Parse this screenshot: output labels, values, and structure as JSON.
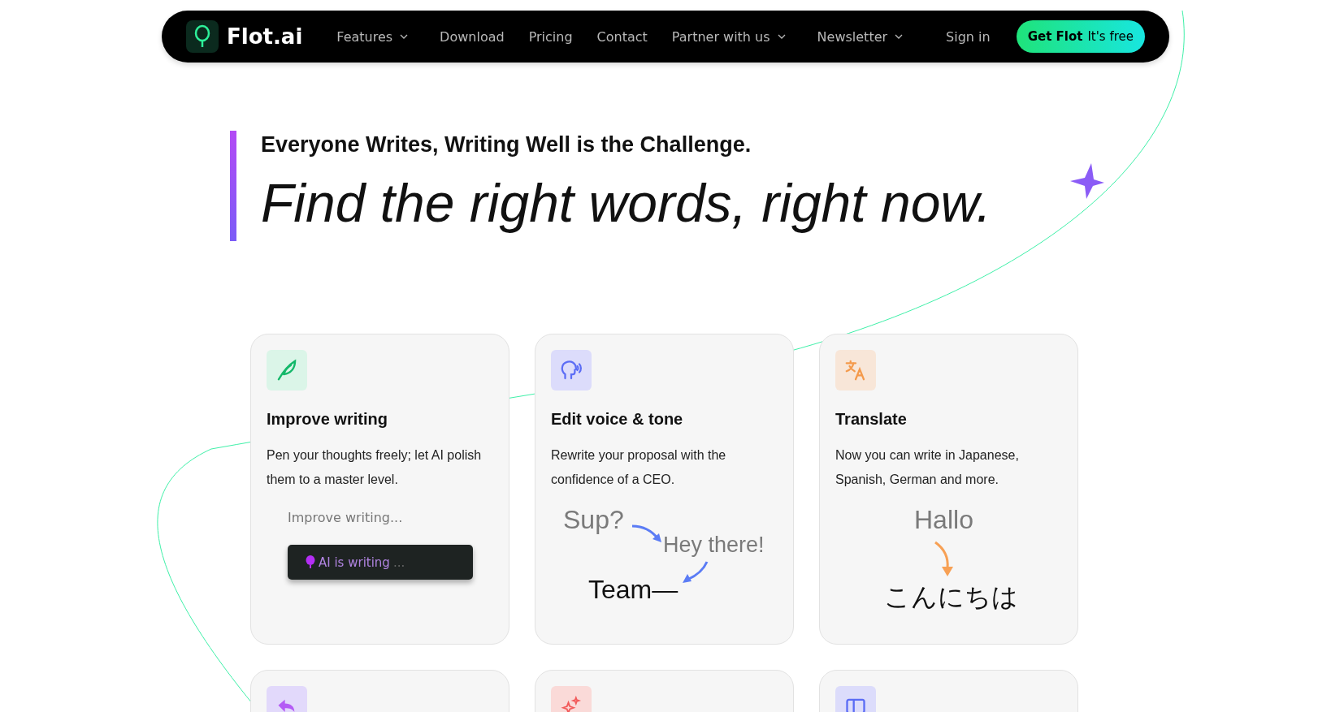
{
  "nav": {
    "brand": "Flot.ai",
    "links": [
      {
        "label": "Features",
        "dropdown": true
      },
      {
        "label": "Download",
        "dropdown": false
      },
      {
        "label": "Pricing",
        "dropdown": false
      },
      {
        "label": "Contact",
        "dropdown": false
      },
      {
        "label": "Partner with us",
        "dropdown": true
      },
      {
        "label": "Newsletter",
        "dropdown": true
      }
    ],
    "sign_in": "Sign in",
    "cta": {
      "strong": "Get Flot",
      "light": "It's free"
    }
  },
  "hero": {
    "subtitle": "Everyone Writes, Writing Well is the Challenge.",
    "headline": "Find the right words, right now."
  },
  "cards": [
    {
      "kind": "writing",
      "title": "Improve writing",
      "text": "Pen your thoughts freely; let AI polish them to a master level.",
      "demo": {
        "prompt": "Improve writing...",
        "status": "AI is writing",
        "dots": "..."
      }
    },
    {
      "kind": "tone",
      "title": "Edit voice & tone",
      "text": "Rewrite your proposal with the confidence of a CEO.",
      "demo": {
        "from": "Sup?",
        "middle": "Hey there!",
        "to": "Team—"
      }
    },
    {
      "kind": "translate",
      "title": "Translate",
      "text": "Now you can write in Japanese, Spanish, German and more.",
      "demo": {
        "from": "Hallo",
        "to": "こんにちは"
      }
    }
  ],
  "more_cards": [
    {
      "kind": "undo"
    },
    {
      "kind": "sparkle"
    },
    {
      "kind": "sidebar"
    }
  ]
}
